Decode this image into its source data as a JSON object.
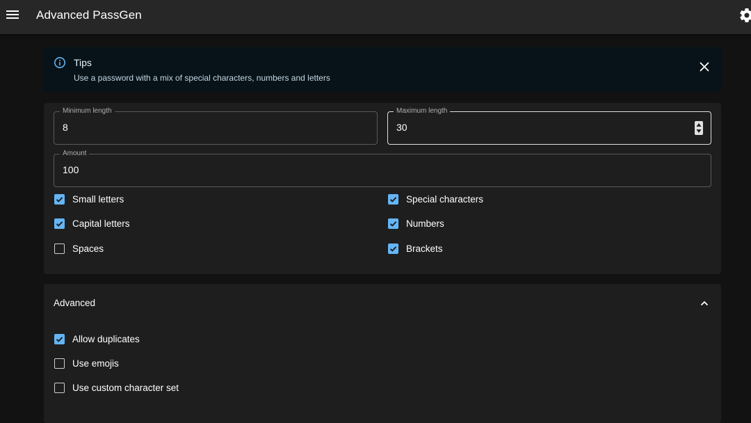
{
  "appbar": {
    "title": "Advanced PassGen",
    "menu_icon": "menu-icon",
    "settings_icon": "gear-icon"
  },
  "tips": {
    "title": "Tips",
    "text": "Use a password with a mix of special characters, numbers and letters",
    "icon": "info-icon",
    "close_icon": "close-icon"
  },
  "form": {
    "min_length": {
      "label": "Minimum length",
      "value": "8"
    },
    "max_length": {
      "label": "Maximum length",
      "value": "30"
    },
    "amount": {
      "label": "Amount",
      "value": "100"
    },
    "options": [
      {
        "label": "Small letters",
        "checked": true
      },
      {
        "label": "Special characters",
        "checked": true
      },
      {
        "label": "Capital letters",
        "checked": true
      },
      {
        "label": "Numbers",
        "checked": true
      },
      {
        "label": "Spaces",
        "checked": false
      },
      {
        "label": "Brackets",
        "checked": true
      }
    ]
  },
  "advanced": {
    "title": "Advanced",
    "expand_icon": "chevron-up-icon",
    "options": [
      {
        "label": "Allow duplicates",
        "checked": true
      },
      {
        "label": "Use emojis",
        "checked": false
      },
      {
        "label": "Use custom character set",
        "checked": false
      }
    ]
  },
  "colors": {
    "accent": "#64b5f6",
    "appbar": "#272727",
    "background": "#121212",
    "card": "#1e1e1e",
    "tips_background": "#071318"
  }
}
